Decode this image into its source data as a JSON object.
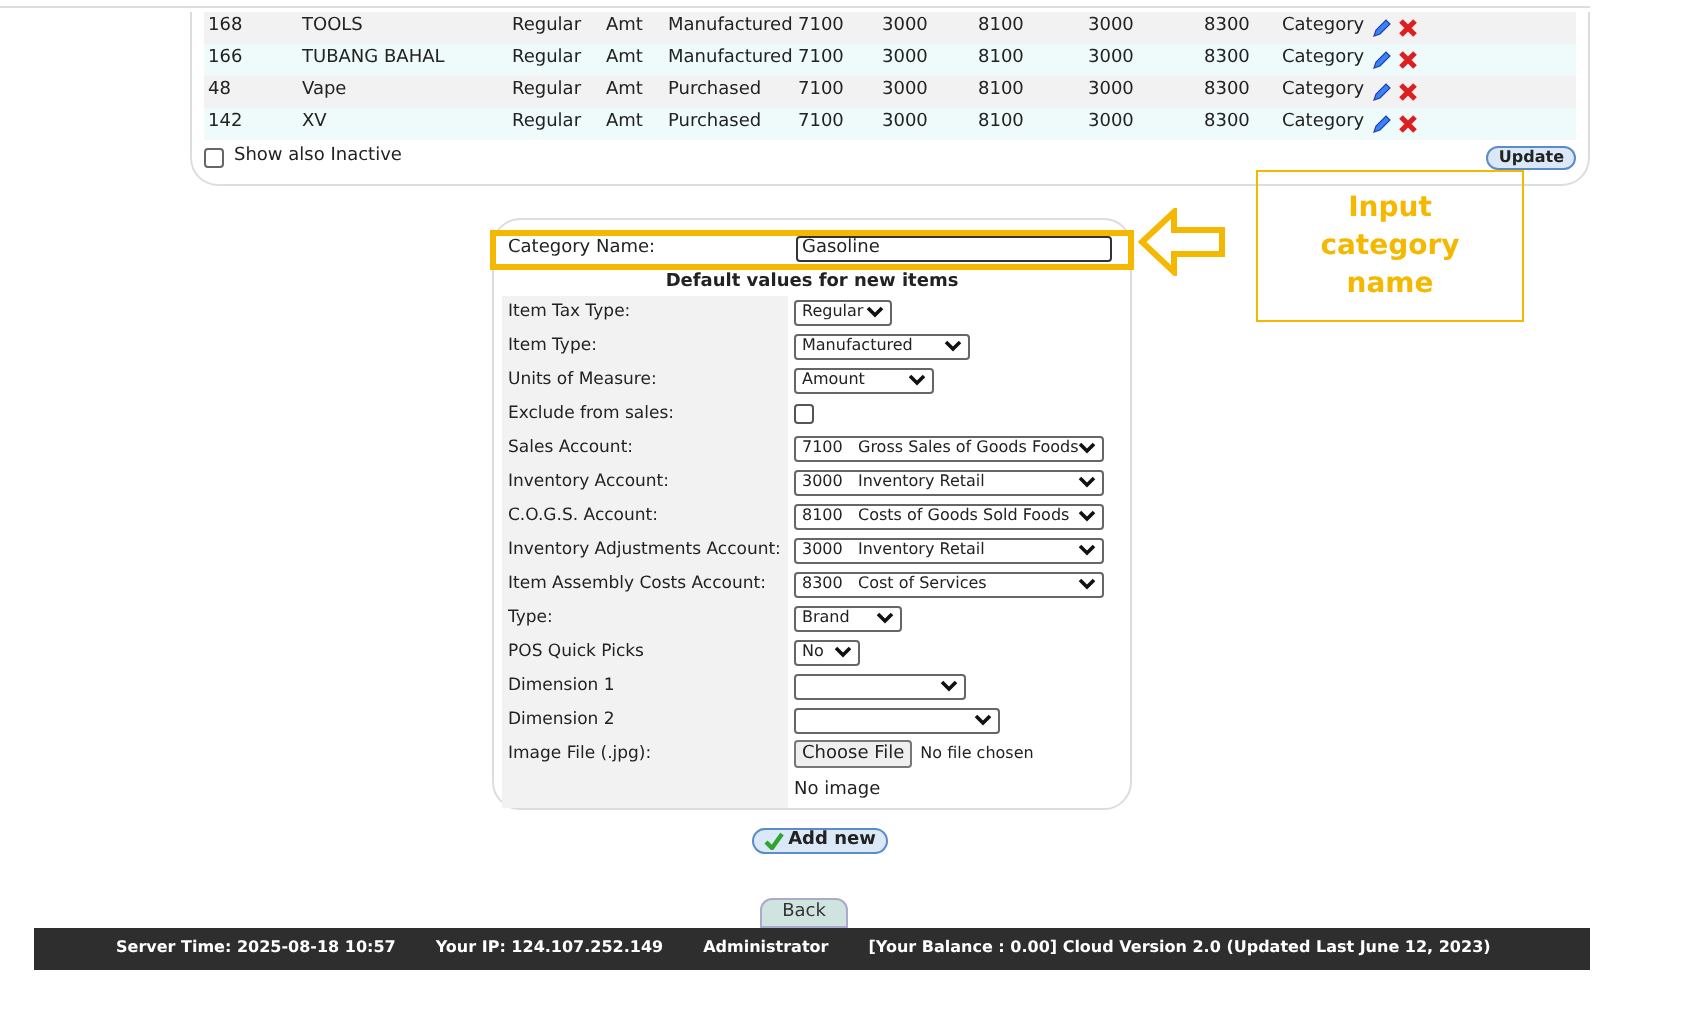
{
  "table": {
    "rows": [
      {
        "cells": [
          "168",
          "TOOLS",
          "Regular",
          "Amt",
          "Manufactured",
          "7100",
          "3000",
          "8100",
          "3000",
          "8300",
          "Category"
        ]
      },
      {
        "cells": [
          "166",
          "TUBANG BAHAL",
          "Regular",
          "Amt",
          "Manufactured",
          "7100",
          "3000",
          "8100",
          "3000",
          "8300",
          "Category"
        ]
      },
      {
        "cells": [
          "48",
          "Vape",
          "Regular",
          "Amt",
          "Purchased",
          "7100",
          "3000",
          "8100",
          "3000",
          "8300",
          "Category"
        ]
      },
      {
        "cells": [
          "142",
          "XV",
          "Regular",
          "Amt",
          "Purchased",
          "7100",
          "3000",
          "8100",
          "3000",
          "8300",
          "Category"
        ]
      }
    ],
    "show_inactive": {
      "label": "Show also Inactive",
      "checked": false
    },
    "update_button": "Update"
  },
  "form": {
    "name_label": "Category Name:",
    "name_value": "Gasoline",
    "section_title": "Default values for new items",
    "fields": [
      {
        "kind": "select",
        "label": "Item Tax Type:",
        "value": "Regular"
      },
      {
        "kind": "select",
        "label": "Item Type:",
        "value": "Manufactured"
      },
      {
        "kind": "select",
        "label": "Units of Measure:",
        "value": "Amount"
      },
      {
        "kind": "checkbox",
        "label": "Exclude from sales:",
        "checked": false
      },
      {
        "kind": "select",
        "label": "Sales Account:",
        "value": "7100   Gross Sales of Goods Foods"
      },
      {
        "kind": "select",
        "label": "Inventory Account:",
        "value": "3000   Inventory Retail"
      },
      {
        "kind": "select",
        "label": "C.O.G.S. Account:",
        "value": "8100   Costs of Goods Sold Foods"
      },
      {
        "kind": "select",
        "label": "Inventory Adjustments Account:",
        "value": "3000   Inventory Retail"
      },
      {
        "kind": "select",
        "label": "Item Assembly Costs Account:",
        "value": "8300   Cost of Services"
      },
      {
        "kind": "select",
        "label": "Type:",
        "value": "Brand"
      },
      {
        "kind": "select",
        "label": "POS Quick Picks",
        "value": "No"
      },
      {
        "kind": "select",
        "label": "Dimension 1"
      },
      {
        "kind": "select",
        "label": "Dimension 2"
      },
      {
        "kind": "file",
        "label": "Image File (.jpg):",
        "button": "Choose File",
        "status": "No file chosen"
      }
    ],
    "no_image": "No image"
  },
  "add_button": "Add new",
  "callout": "Input category name",
  "back_button": "Back",
  "footer": {
    "server_time": "Server Time: 2025-08-18 10:57",
    "ip": "Your IP: 124.107.252.149",
    "user": "Administrator",
    "version": "[Your Balance : 0.00] Cloud Version 2.0 (Updated Last June 12, 2023)"
  }
}
